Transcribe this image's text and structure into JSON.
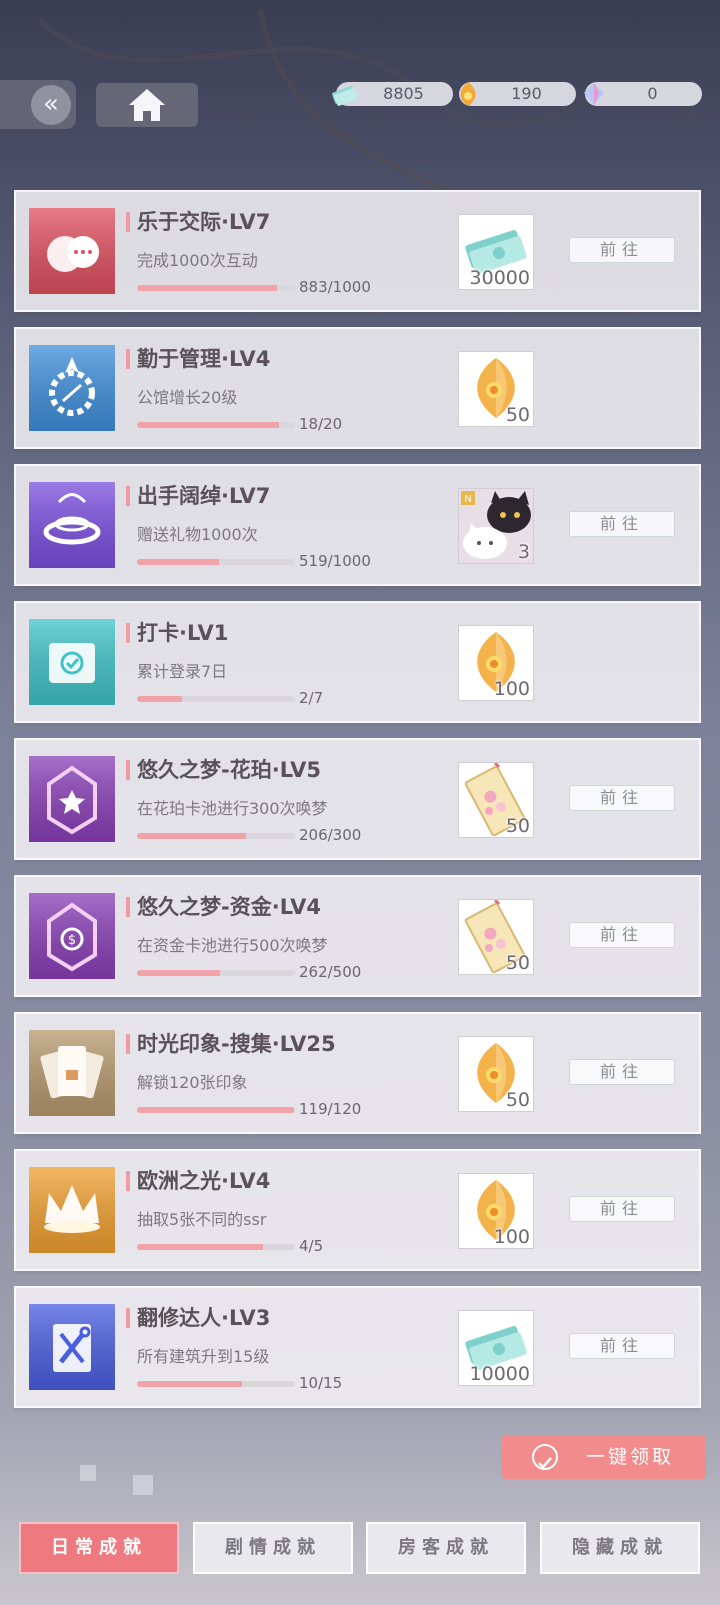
{
  "currencies": [
    {
      "icon": "cash-stack-icon",
      "value": "8805"
    },
    {
      "icon": "amber-gem-icon",
      "value": "190"
    },
    {
      "icon": "crystal-icon",
      "value": "0"
    }
  ],
  "nav": {
    "back_icon": "double-chevron-left-icon",
    "home_icon": "home-icon"
  },
  "achievements": [
    {
      "title": "乐于交际·LV7",
      "desc": "完成1000次互动",
      "progress": 0.883,
      "progress_text": "883/1000",
      "reward_icon": "cash-stack-icon",
      "reward_amount": "30000",
      "action": "前往",
      "icon": "chat-bubbles-icon",
      "icon_color": "#e0505f"
    },
    {
      "title": "勤于管理·LV4",
      "desc": "公馆增长20级",
      "progress": 0.9,
      "progress_text": "18/20",
      "reward_icon": "amber-gem-icon",
      "reward_amount": "50",
      "action": "",
      "icon": "gear-compass-icon",
      "icon_color": "#3f8fdc"
    },
    {
      "title": "出手阔绰·LV7",
      "desc": "赠送礼物1000次",
      "progress": 0.519,
      "progress_text": "519/1000",
      "reward_icon": "cat-plush-icon",
      "reward_amount": "3",
      "action": "前往",
      "icon": "gift-ring-icon",
      "icon_color": "#7b4fe0"
    },
    {
      "title": "打卡·LV1",
      "desc": "累计登录7日",
      "progress": 0.286,
      "progress_text": "2/7",
      "reward_icon": "amber-gem-icon",
      "reward_amount": "100",
      "action": "",
      "icon": "check-calendar-icon",
      "icon_color": "#3fc3c8"
    },
    {
      "title": "悠久之梦-花珀·LV5",
      "desc": "在花珀卡池进行300次唤梦",
      "progress": 0.687,
      "progress_text": "206/300",
      "reward_icon": "flower-ticket-icon",
      "reward_amount": "50",
      "action": "前往",
      "icon": "star-crest-icon",
      "icon_color": "#8a3fb8"
    },
    {
      "title": "悠久之梦-资金·LV4",
      "desc": "在资金卡池进行500次唤梦",
      "progress": 0.524,
      "progress_text": "262/500",
      "reward_icon": "flower-ticket-icon",
      "reward_amount": "50",
      "action": "前往",
      "icon": "coin-crest-icon",
      "icon_color": "#8a3fb8"
    },
    {
      "title": "时光印象-搜集·LV25",
      "desc": "解锁120张印象",
      "progress": 0.992,
      "progress_text": "119/120",
      "reward_icon": "amber-gem-icon",
      "reward_amount": "50",
      "action": "前往",
      "icon": "card-lock-icon",
      "icon_color": "#b89a70"
    },
    {
      "title": "欧洲之光·LV4",
      "desc": "抽取5张不同的ssr",
      "progress": 0.8,
      "progress_text": "4/5",
      "reward_icon": "amber-gem-icon",
      "reward_amount": "100",
      "action": "前往",
      "icon": "crown-icon",
      "icon_color": "#f0a030"
    },
    {
      "title": "翻修达人·LV3",
      "desc": "所有建筑升到15级",
      "progress": 0.667,
      "progress_text": "10/15",
      "reward_icon": "cash-stack-icon",
      "reward_amount": "10000",
      "action": "前往",
      "icon": "wrench-screwdriver-icon",
      "icon_color": "#4a5fe0"
    }
  ],
  "claim_all": {
    "label": "一键领取",
    "icon": "check-circle-icon"
  },
  "tabs": [
    {
      "label": "日常成就",
      "active": true
    },
    {
      "label": "剧情成就",
      "active": false
    },
    {
      "label": "房客成就",
      "active": false
    },
    {
      "label": "隐藏成就",
      "active": false
    }
  ]
}
